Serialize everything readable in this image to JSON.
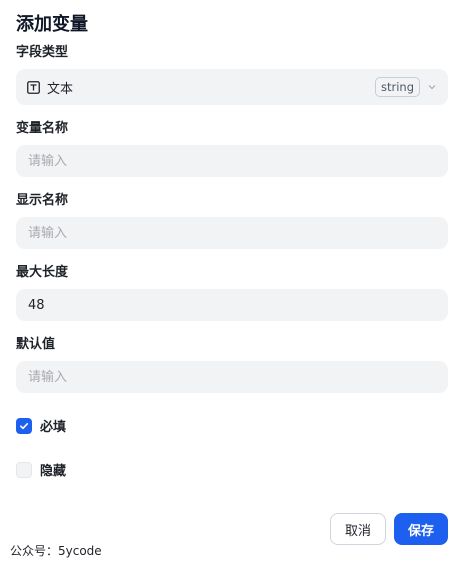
{
  "dialog": {
    "title": "添加变量"
  },
  "field_type": {
    "label": "字段类型",
    "value": "文本",
    "badge": "string",
    "icon": "text-type-icon"
  },
  "var_name": {
    "label": "变量名称",
    "placeholder": "请输入",
    "value": ""
  },
  "display_name": {
    "label": "显示名称",
    "placeholder": "请输入",
    "value": ""
  },
  "max_length": {
    "label": "最大长度",
    "value": "48"
  },
  "default_value": {
    "label": "默认值",
    "placeholder": "请输入",
    "value": ""
  },
  "required": {
    "label": "必填",
    "checked": true
  },
  "hidden": {
    "label": "隐藏",
    "checked": false
  },
  "buttons": {
    "cancel": "取消",
    "save": "保存"
  },
  "watermark": "公众号：5ycode",
  "colors": {
    "accent": "#1d5fef",
    "field_bg": "#f2f3f5"
  }
}
